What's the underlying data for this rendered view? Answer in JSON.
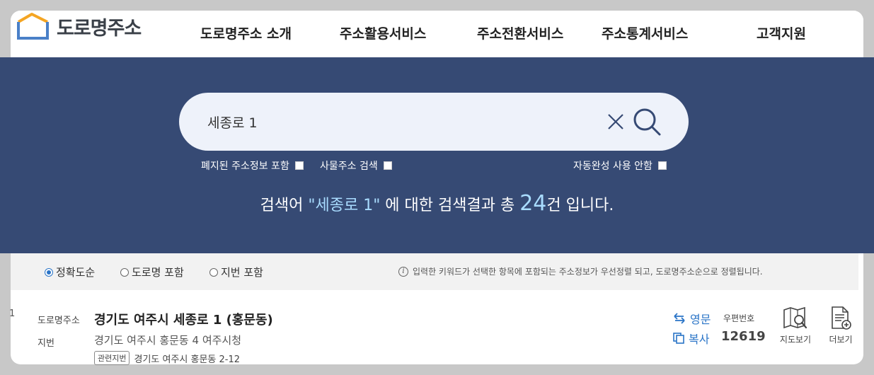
{
  "header": {
    "logo_text": "도로명주소",
    "nav": [
      "도로명주소 소개",
      "주소활용서비스",
      "주소전환서비스",
      "주소통계서비스",
      "고객지원"
    ]
  },
  "search": {
    "value": "세종로 1",
    "options": {
      "include_abolished": "폐지된 주소정보 포함",
      "thing_address": "사물주소 검색",
      "autocomplete_off": "자동완성 사용 안함"
    }
  },
  "result_message": {
    "prefix": "검색어 ",
    "keyword": "\"세종로 1\"",
    "middle": " 에 대한 검색결과 총 ",
    "count": "24",
    "suffix": "건 입니다."
  },
  "filters": {
    "options": [
      "정확도순",
      "도로명 포함",
      "지번 포함"
    ],
    "selected": "정확도순",
    "note": "입력한 키워드가 선택한 항목에 포함되는 주소정보가 우선정렬 되고, 도로명주소순으로 정렬됩니다."
  },
  "results": [
    {
      "num": "1",
      "road_label": "도로명주소",
      "road_address": "경기도 여주시 세종로 1 (홍문동)",
      "jibun_label": "지번",
      "jibun_address": "경기도 여주시 홍문동 4 여주시청",
      "related_badge": "관련지번",
      "related_address": "경기도 여주시 홍문동 2-12",
      "english_label": "영문",
      "copy_label": "복사",
      "postal_label": "우편번호",
      "postal_code": "12619",
      "map_label": "지도보기",
      "more_label": "더보기"
    }
  ],
  "colors": {
    "band": "#364a74",
    "accent": "#2a74c7",
    "highlight": "#a9dcff",
    "logo_orange": "#f4a523",
    "logo_blue": "#4a80c8"
  }
}
